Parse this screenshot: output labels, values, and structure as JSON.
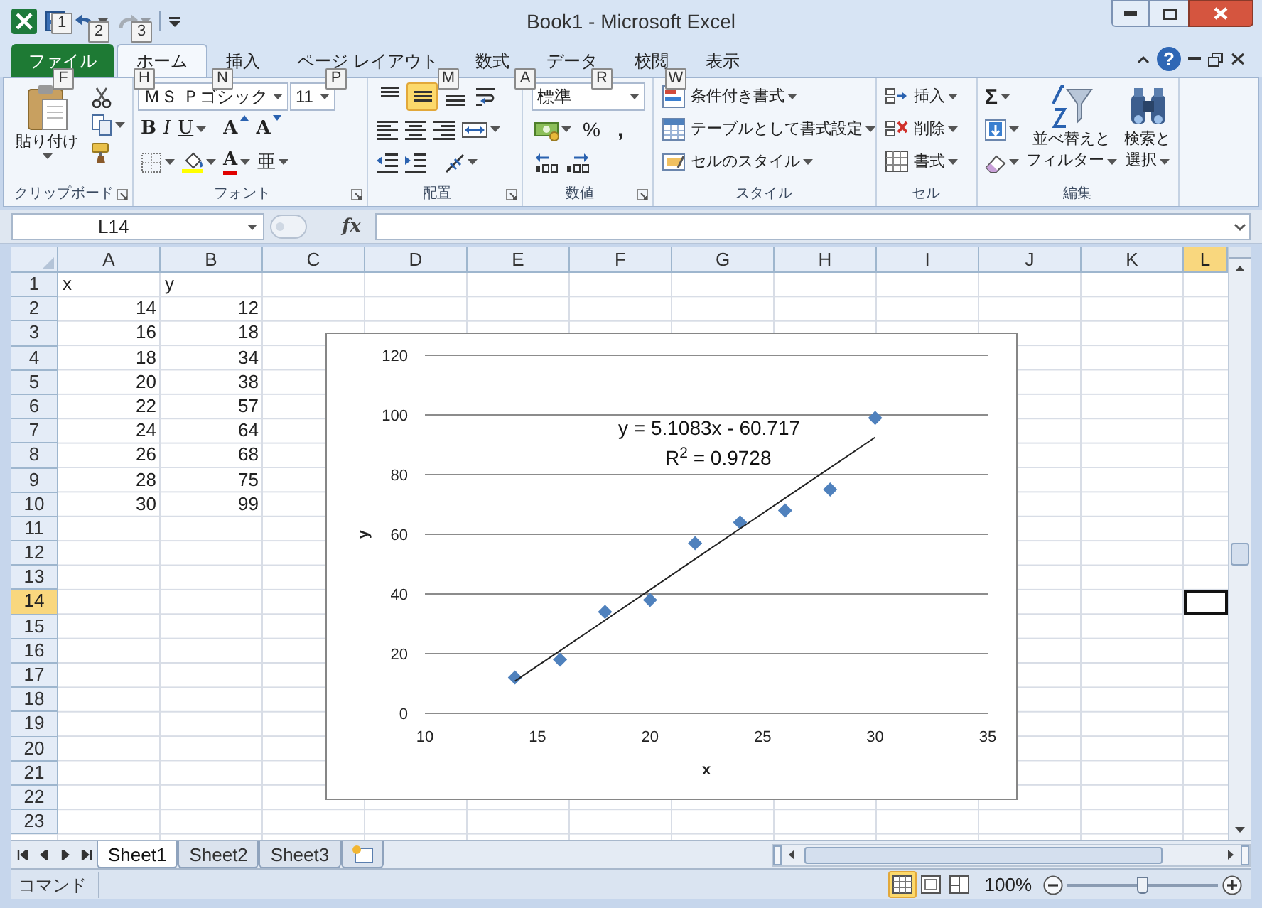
{
  "title_bar": {
    "title": "Book1 - Microsoft Excel",
    "keytips": [
      "1",
      "2",
      "3"
    ]
  },
  "ribbon_tabs": [
    {
      "label": "ファイル",
      "keytip": "F",
      "selected": false,
      "kind": "file"
    },
    {
      "label": "ホーム",
      "keytip": "H",
      "selected": true,
      "kind": "tab"
    },
    {
      "label": "挿入",
      "keytip": "N",
      "selected": false,
      "kind": "tab"
    },
    {
      "label": "ページ レイアウト",
      "keytip": "P",
      "selected": false,
      "kind": "tab"
    },
    {
      "label": "数式",
      "keytip": "M",
      "selected": false,
      "kind": "tab"
    },
    {
      "label": "データ",
      "keytip": "A",
      "selected": false,
      "kind": "tab"
    },
    {
      "label": "校閲",
      "keytip": "R",
      "selected": false,
      "kind": "tab"
    },
    {
      "label": "表示",
      "keytip": "W",
      "selected": false,
      "kind": "tab"
    }
  ],
  "help_glyph": "?",
  "ribbon_groups": [
    {
      "kind": "clipboard",
      "title": "クリップボード",
      "paste_label": "貼り付け"
    },
    {
      "kind": "font",
      "title": "フォント",
      "font_name": "ＭＳ Ｐゴシック",
      "font_size": "11",
      "glyphs": [
        "B",
        "I",
        "U",
        "A",
        "A",
        "A",
        "亜"
      ]
    },
    {
      "kind": "alignment",
      "title": "配置",
      "vertical_align": [
        {
          "selected": false
        },
        {
          "selected": true
        },
        {
          "selected": false
        }
      ]
    },
    {
      "kind": "number",
      "title": "数値",
      "format": "標準",
      "glyphs": [
        "%",
        ","
      ]
    },
    {
      "kind": "styles",
      "title": "スタイル",
      "items": [
        "条件付き書式",
        "テーブルとして書式設定",
        "セルのスタイル"
      ]
    },
    {
      "kind": "cells",
      "title": "セル",
      "items": [
        "挿入",
        "削除",
        "書式"
      ]
    },
    {
      "kind": "editing",
      "title": "編集",
      "glyph": "Σ",
      "buttons": [
        {
          "lines": [
            "並べ替えと",
            "フィルター"
          ]
        },
        {
          "lines": [
            "検索と",
            "選択"
          ]
        }
      ]
    }
  ],
  "formula_bar": {
    "name_box": "L14",
    "fx": "fx"
  },
  "sheet": {
    "columns": [
      {
        "label": "A",
        "selected": false
      },
      {
        "label": "B",
        "selected": false
      },
      {
        "label": "C",
        "selected": false
      },
      {
        "label": "D",
        "selected": false
      },
      {
        "label": "E",
        "selected": false
      },
      {
        "label": "F",
        "selected": false
      },
      {
        "label": "G",
        "selected": false
      },
      {
        "label": "H",
        "selected": false
      },
      {
        "label": "I",
        "selected": false
      },
      {
        "label": "J",
        "selected": false
      },
      {
        "label": "K",
        "selected": false
      },
      {
        "label": "L",
        "selected": true
      }
    ],
    "rows": [
      {
        "header": "1",
        "selected": false,
        "cells": [
          {
            "value": "x",
            "kind": "text"
          },
          {
            "value": "y",
            "kind": "text"
          }
        ]
      },
      {
        "header": "2",
        "selected": false,
        "cells": [
          {
            "value": "14",
            "kind": "number"
          },
          {
            "value": "12",
            "kind": "number"
          }
        ]
      },
      {
        "header": "3",
        "selected": false,
        "cells": [
          {
            "value": "16",
            "kind": "number"
          },
          {
            "value": "18",
            "kind": "number"
          }
        ]
      },
      {
        "header": "4",
        "selected": false,
        "cells": [
          {
            "value": "18",
            "kind": "number"
          },
          {
            "value": "34",
            "kind": "number"
          }
        ]
      },
      {
        "header": "5",
        "selected": false,
        "cells": [
          {
            "value": "20",
            "kind": "number"
          },
          {
            "value": "38",
            "kind": "number"
          }
        ]
      },
      {
        "header": "6",
        "selected": false,
        "cells": [
          {
            "value": "22",
            "kind": "number"
          },
          {
            "value": "57",
            "kind": "number"
          }
        ]
      },
      {
        "header": "7",
        "selected": false,
        "cells": [
          {
            "value": "24",
            "kind": "number"
          },
          {
            "value": "64",
            "kind": "number"
          }
        ]
      },
      {
        "header": "8",
        "selected": false,
        "cells": [
          {
            "value": "26",
            "kind": "number"
          },
          {
            "value": "68",
            "kind": "number"
          }
        ]
      },
      {
        "header": "9",
        "selected": false,
        "cells": [
          {
            "value": "28",
            "kind": "number"
          },
          {
            "value": "75",
            "kind": "number"
          }
        ]
      },
      {
        "header": "10",
        "selected": false,
        "cells": [
          {
            "value": "30",
            "kind": "number"
          },
          {
            "value": "99",
            "kind": "number"
          }
        ]
      },
      {
        "header": "11",
        "selected": false
      },
      {
        "header": "12",
        "selected": false
      },
      {
        "header": "13",
        "selected": false
      },
      {
        "header": "14",
        "selected": true
      },
      {
        "header": "15",
        "selected": false
      },
      {
        "header": "16",
        "selected": false
      },
      {
        "header": "17",
        "selected": false
      },
      {
        "header": "18",
        "selected": false
      },
      {
        "header": "19",
        "selected": false
      },
      {
        "header": "20",
        "selected": false
      },
      {
        "header": "21",
        "selected": false
      },
      {
        "header": "22",
        "selected": false
      },
      {
        "header": "23",
        "selected": false
      }
    ],
    "chart": {
      "chart_data": {
        "type": "scatter",
        "xlabel": "x",
        "ylabel": "y",
        "x": [
          14,
          16,
          18,
          20,
          22,
          24,
          26,
          28,
          30
        ],
        "series": [
          {
            "color": "#4f81bd",
            "values": [
              12,
              18,
              34,
              38,
              57,
              64,
              68,
              75,
              99
            ]
          },
          {
            "type": "line",
            "color": "#222222",
            "values": [
              10.8,
              21.0,
              31.2,
              41.4,
              51.7,
              61.9,
              72.1,
              82.3,
              92.5
            ]
          }
        ],
        "grid": true,
        "xlim": [
          10,
          35
        ],
        "ylim": [
          0,
          120
        ],
        "xticks": [
          10,
          15,
          20,
          25,
          30,
          35
        ],
        "yticks": [
          0,
          20,
          40,
          60,
          80,
          100,
          120
        ],
        "annotations": [
          {
            "text": "y = 5.1083x - 60.717"
          },
          {
            "text": "R$^{2}$ = 0.9728"
          }
        ]
      }
    }
  },
  "sheet_tabs": [
    {
      "label": "Sheet1",
      "selected": true
    },
    {
      "label": "Sheet2",
      "selected": false
    },
    {
      "label": "Sheet3",
      "selected": false
    }
  ],
  "status_bar": {
    "mode": "コマンド",
    "views": [
      {
        "selected": true
      },
      {
        "selected": false
      },
      {
        "selected": false
      }
    ],
    "zoom": "100%",
    "zoom_slider": {
      "level": 0.5
    }
  }
}
